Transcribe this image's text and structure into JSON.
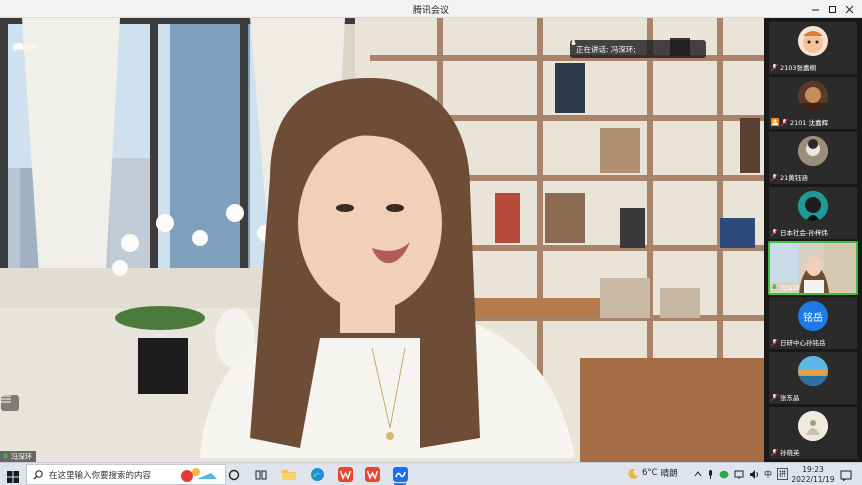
{
  "window": {
    "title": "腾讯会议"
  },
  "meeting": {
    "recording_label": "录制中",
    "speaking_label": "正在讲话: 冯深环;",
    "self_name": "冯深环"
  },
  "participants": [
    {
      "name": "2103张嘉桐",
      "avatar": "cartoon-avatar"
    },
    {
      "name": "2101 沈嘉辉",
      "avatar": "photo-avatar"
    },
    {
      "name": "21黄钰涵",
      "avatar": "photo-avatar"
    },
    {
      "name": "日本社会-孙梓炜",
      "avatar": "teal-avatar"
    },
    {
      "name": "冯深环",
      "avatar": "video",
      "active": true
    },
    {
      "name": "日研中心孙铭岳",
      "avatar": "text-avatar",
      "avatar_text": "铭岳"
    },
    {
      "name": "张东晶",
      "avatar": "landscape-avatar"
    },
    {
      "name": "孙晓英",
      "avatar": "photo-avatar"
    }
  ],
  "taskbar": {
    "search_placeholder": "在这里输入你要搜索的内容",
    "weather_temp": "6°C",
    "weather_desc": "晴朗",
    "ime_label": "中",
    "ime_mode": "拼",
    "time": "19:23",
    "date": "2022/11/19"
  },
  "colors": {
    "accent_green": "#3fbf3f",
    "avatar_blue": "#1e7be6",
    "taskbar": "#dfe3ec"
  }
}
